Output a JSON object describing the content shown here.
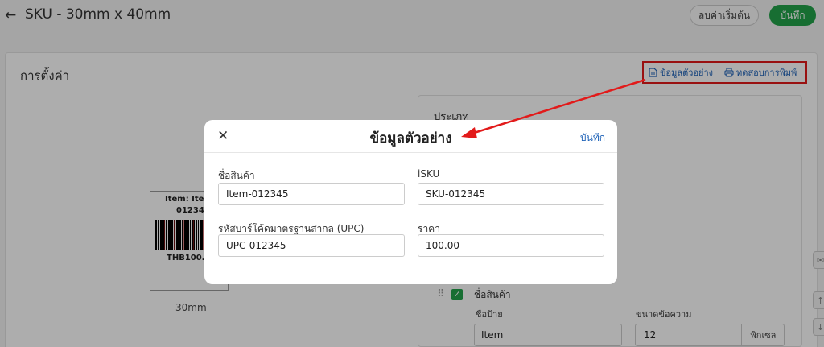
{
  "header": {
    "back_icon": "arrow-left-icon",
    "title": "SKU - 30mm x 40mm",
    "reset_label": "ลบค่าเริ่มต้น",
    "save_label": "บันทึก"
  },
  "card": {
    "title": "การตั้งค่า",
    "actions": {
      "sample_label": "ข้อมูลตัวอย่าง",
      "print_label": "ทดสอบการพิมพ์"
    }
  },
  "preview": {
    "name_text": "Item: Iter",
    "code_text": "012345",
    "price_text": "THB100.0",
    "width_label": "30mm"
  },
  "panel": {
    "type_label": "ประเภท",
    "field_label": "ชื่อสินค้า",
    "sign_label": "ชื่อป้าย",
    "sign_value": "Item",
    "size_label": "ขนาดข้อความ",
    "size_value": "12",
    "size_unit": "พิกเซล"
  },
  "modal": {
    "title": "ข้อมูลตัวอย่าง",
    "save_label": "บันทึก",
    "close_icon": "close-icon",
    "fields": [
      {
        "label": "ชื่อสินค้า",
        "value": "Item-012345"
      },
      {
        "label": "iSKU",
        "value": "SKU-012345"
      },
      {
        "label": "รหัสบาร์โค้ดมาตรฐานสากล (UPC)",
        "value": "UPC-012345"
      },
      {
        "label": "ราคา",
        "value": "100.00"
      }
    ]
  },
  "colors": {
    "accent_green": "#22a34a",
    "link_blue": "#1f63b8",
    "annotation_red": "#e21a1a"
  }
}
